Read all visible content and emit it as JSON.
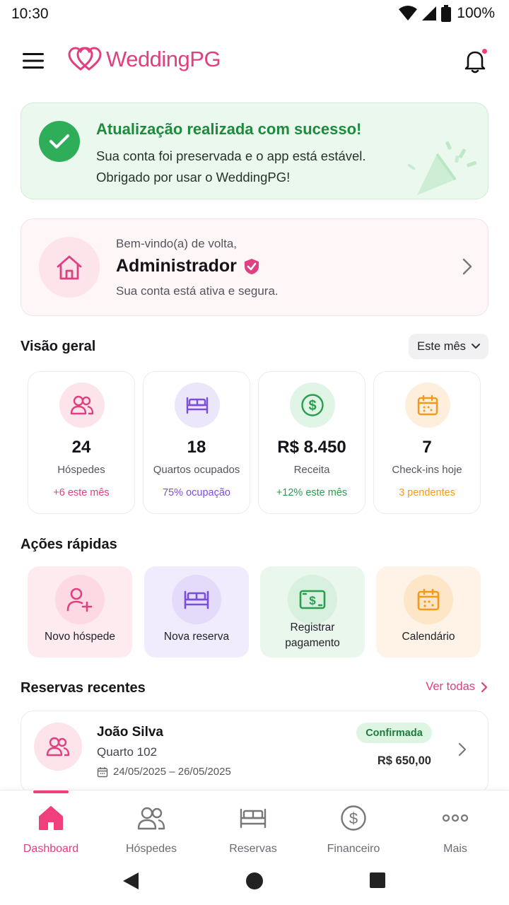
{
  "status_bar": {
    "time": "10:30",
    "battery": "100%"
  },
  "app": {
    "name": "WeddingPG"
  },
  "success": {
    "title": "Atualização realizada com sucesso!",
    "line1": "Sua conta foi preservada e o app está estável.",
    "line2": "Obrigado por usar o WeddingPG!"
  },
  "welcome": {
    "greeting": "Bem-vindo(a) de volta,",
    "name": "Administrador",
    "subtitle": "Sua conta está ativa e segura."
  },
  "overview": {
    "title": "Visão geral",
    "period": "Este mês",
    "stats": [
      {
        "value": "24",
        "label": "Hóspedes",
        "note": "+6 este mês",
        "icon": "users-icon",
        "color": "#e0407f"
      },
      {
        "value": "18",
        "label": "Quartos ocupados",
        "note": "75% ocupação",
        "icon": "bed-icon",
        "color": "#7c4ddb"
      },
      {
        "value": "R$ 8.450",
        "label": "Receita",
        "note": "+12% este mês",
        "icon": "dollar-icon",
        "color": "#2a9d4f"
      },
      {
        "value": "7",
        "label": "Check-ins hoje",
        "note": "3 pendentes",
        "icon": "calendar-icon",
        "color": "#f39a1c"
      }
    ]
  },
  "quick_actions": {
    "title": "Ações rápidas",
    "items": [
      {
        "label": "Novo hóspede",
        "icon": "user-plus-icon"
      },
      {
        "label": "Nova reserva",
        "icon": "bed-icon"
      },
      {
        "label_line1": "Registrar",
        "label_line2": "pagamento",
        "icon": "cash-icon"
      },
      {
        "label": "Calendário",
        "icon": "calendar-icon"
      }
    ]
  },
  "recent": {
    "title": "Reservas recentes",
    "see_all": "Ver todas",
    "bookings": [
      {
        "name": "João Silva",
        "room": "Quarto 102",
        "dates": "24/05/2025 – 26/05/2025",
        "status": "Confirmada",
        "price": "R$ 650,00"
      }
    ]
  },
  "bottom_nav": {
    "items": [
      {
        "label": "Dashboard",
        "icon": "home-icon",
        "active": true
      },
      {
        "label": "Hóspedes",
        "icon": "users-icon"
      },
      {
        "label": "Reservas",
        "icon": "bed-icon"
      },
      {
        "label": "Financeiro",
        "icon": "dollar-icon"
      },
      {
        "label": "Mais",
        "icon": "more-icon"
      }
    ]
  },
  "colors": {
    "brand": "#e0407f",
    "success": "#2fae5a",
    "purple": "#7c4ddb",
    "green": "#2a9d4f",
    "orange": "#f39a1c"
  }
}
